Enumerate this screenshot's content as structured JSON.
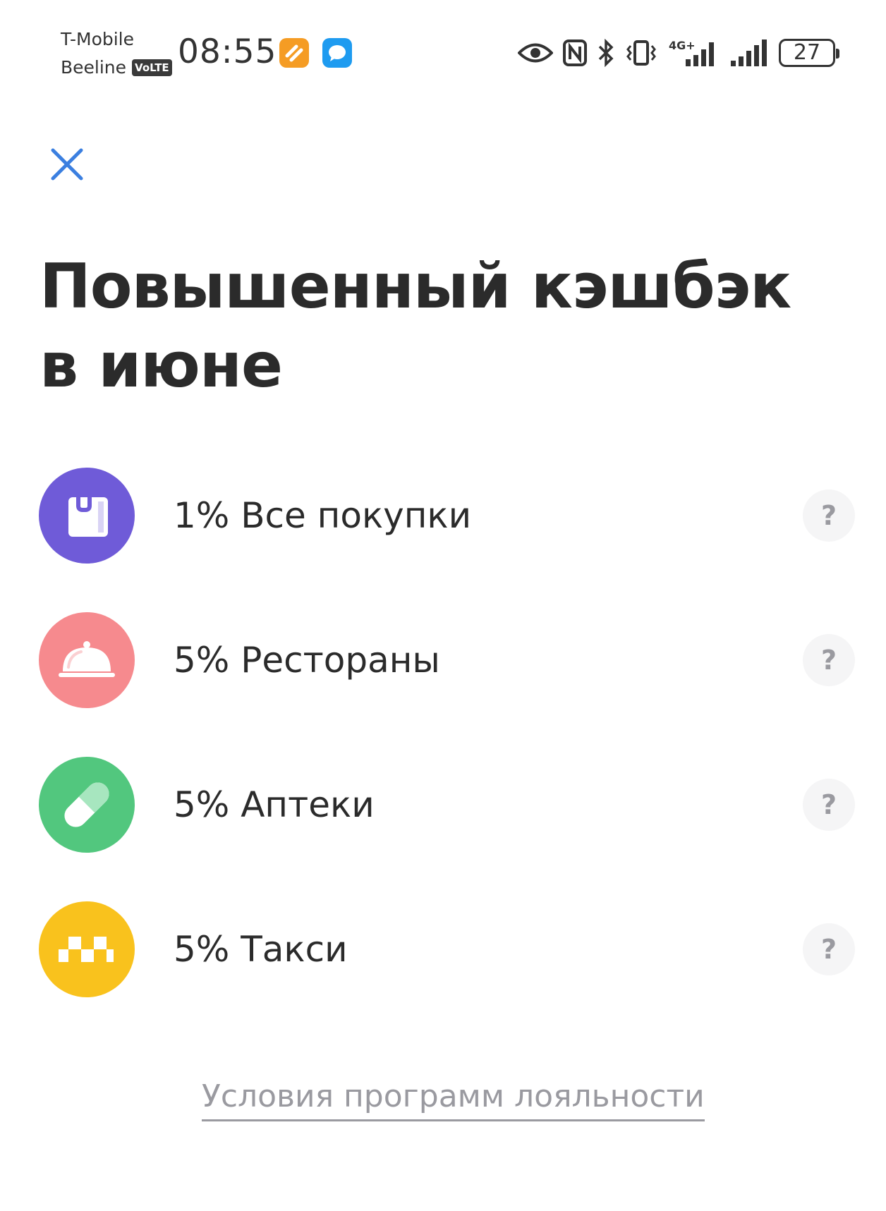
{
  "status_bar": {
    "carrier_1": "T-Mobile",
    "carrier_2": "Beeline",
    "volte_badge": "VoLTE",
    "time": "08:55",
    "network_label": "4G+",
    "battery_level": "27",
    "icons": [
      "orange-app-notification-icon",
      "message-notification-icon",
      "eye-icon",
      "nfc-icon",
      "bluetooth-icon",
      "vibrate-icon",
      "signal-4g-icon",
      "signal-icon",
      "battery-icon"
    ]
  },
  "header": {
    "close_icon": "close-icon",
    "title": "Повышенный кэшбэк в июне"
  },
  "cashback_items": [
    {
      "label": "1% Все покупки",
      "icon": "shopping-bag-icon",
      "color": "#6f5bd8",
      "help": "?"
    },
    {
      "label": "5% Рестораны",
      "icon": "cloche-icon",
      "color": "#f68a8e",
      "help": "?"
    },
    {
      "label": "5% Аптеки",
      "icon": "pill-icon",
      "color": "#52c77e",
      "help": "?"
    },
    {
      "label": "5% Такси",
      "icon": "taxi-checker-icon",
      "color": "#f9c21d",
      "help": "?"
    }
  ],
  "footer": {
    "loyalty_link": "Условия программ лояльности"
  },
  "colors": {
    "accent_close": "#3b7fe0",
    "text_primary": "#2b2b2b",
    "text_muted": "#9a9aa0"
  }
}
